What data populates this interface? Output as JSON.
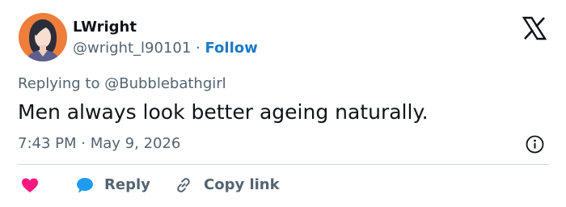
{
  "tweet": {
    "display_name": "LWright",
    "handle": "@wright_l90101",
    "separator": "·",
    "follow_label": "Follow",
    "replying_to_label": "Replying to",
    "replying_to_handle": "@Bubblebathgirl",
    "text": "Men always look better ageing naturally.",
    "time": "7:43 PM",
    "time_separator": "·",
    "date": "May 9, 2026"
  },
  "actions": {
    "like_icon": "heart-icon",
    "reply_icon": "speech-bubble-icon",
    "reply_label": "Reply",
    "copy_icon": "link-icon",
    "copy_label": "Copy link"
  },
  "icons": {
    "brand": "x-logo-icon",
    "info": "info-icon",
    "avatar": "avatar"
  },
  "colors": {
    "accent": "#1d79c6",
    "like": "#f91880",
    "reply_icon": "#1d9bf0",
    "muted_text": "#536471",
    "primary_text": "#0f1419",
    "divider": "#cfd9de",
    "avatar_bg": "#ef7d3c"
  }
}
